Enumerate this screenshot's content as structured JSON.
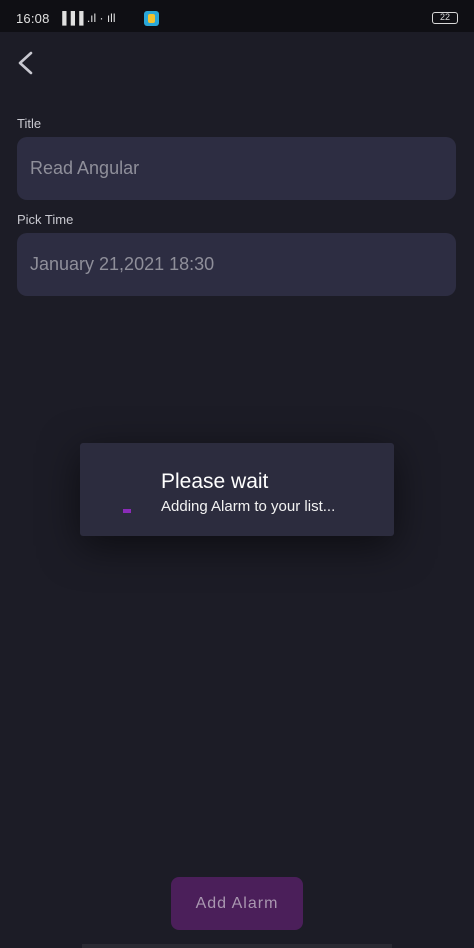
{
  "status_bar": {
    "time": "16:08",
    "signal": "▐▐▐ .ıl · ıll",
    "battery": "22"
  },
  "form": {
    "title_label": "Title",
    "title_value": "Read Angular",
    "time_label": "Pick Time",
    "time_value": "January 21,2021 18:30"
  },
  "dialog": {
    "title": "Please wait",
    "message": "Adding Alarm to your list..."
  },
  "actions": {
    "add_alarm": "Add Alarm"
  },
  "colors": {
    "background": "#1c1c26",
    "field": "#2d2d42",
    "dialog": "#2c2c3e",
    "accent": "#8a2bb8",
    "button": "#4b1f5a"
  },
  "icons": {
    "back": "chevron-left-icon",
    "battery": "battery-icon",
    "app_badge": "app-notification-icon",
    "spinner": "progress-spinner-icon"
  }
}
